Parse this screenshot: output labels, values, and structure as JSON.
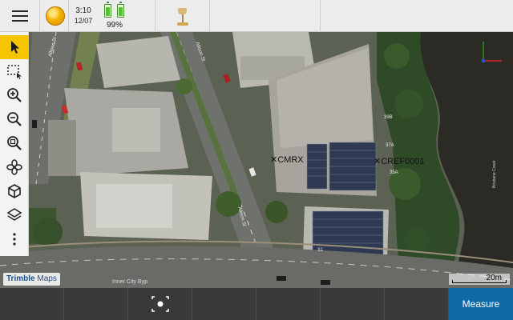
{
  "status": {
    "time": "3:10",
    "date": "12/07",
    "battery_percent": "99%"
  },
  "map": {
    "labels": {
      "point_1": "CMRX",
      "point_2": "CREF0001",
      "street_1": "Allison St",
      "street_2": "Allison St",
      "street_3": "Allison St",
      "road_bottom": "Inner City Byp",
      "river_label": "Brisbane Creek",
      "bldg_39b": "39B",
      "bldg_37a": "37A",
      "bldg_35a": "35A",
      "bldg_31": "31"
    },
    "logo_brand": "Trimble",
    "logo_suffix": "Maps",
    "scale": "20m"
  },
  "toolbar": {
    "tools": [
      "select-arrow-icon",
      "select-rectangle-icon",
      "zoom-in-icon",
      "zoom-out-icon",
      "zoom-extents-icon",
      "pan-icon",
      "3d-view-icon",
      "layers-icon",
      "more-icon"
    ]
  },
  "bottom": {
    "measure_label": "Measure"
  },
  "colors": {
    "accent": "#f6c400",
    "measure_button": "#0e6aa6",
    "battery": "#5bbd2f"
  }
}
